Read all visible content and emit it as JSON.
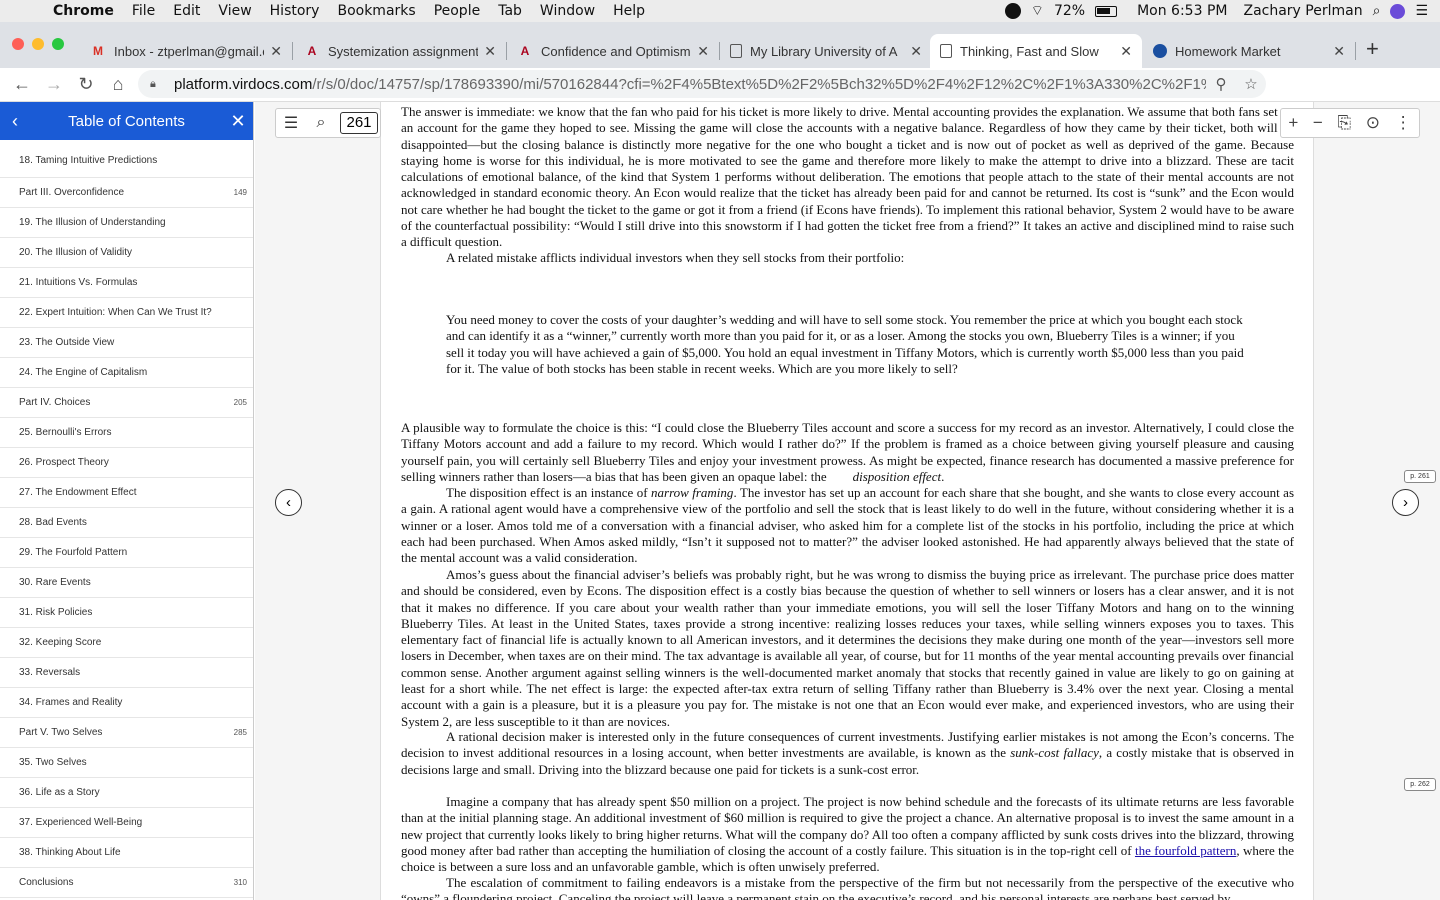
{
  "menubar": {
    "items": [
      "Chrome",
      "File",
      "Edit",
      "View",
      "History",
      "Bookmarks",
      "People",
      "Tab",
      "Window",
      "Help"
    ],
    "battery": "72%",
    "clock": "Mon 6:53 PM",
    "user": "Zachary Perlman"
  },
  "tabs": [
    {
      "title": "Inbox - ztperlman@gmail.c",
      "icon": "gmail-icon"
    },
    {
      "title": "Systemization assignment",
      "icon": "arizona-icon"
    },
    {
      "title": "Confidence and Optimism",
      "icon": "arizona-icon"
    },
    {
      "title": "My Library University of A",
      "icon": "document-icon"
    },
    {
      "title": "Thinking, Fast and Slow",
      "icon": "document-icon"
    },
    {
      "title": "Homework Market",
      "icon": "homework-icon"
    }
  ],
  "address": {
    "host": "platform.virdocs.com",
    "path": "/r/s/0/doc/14757/sp/178693390/mi/570162844?cfi=%2F4%5Btext%5D%2F2%5Bch32%5D%2F4%2F12%2C%2F1%3A330%2C%2F1%3..."
  },
  "sidebar": {
    "title": "Table of Contents",
    "items": [
      {
        "label": "18. Taming Intuitive Predictions",
        "page": ""
      },
      {
        "label": "Part III. Overconfidence",
        "page": "149"
      },
      {
        "label": "19. The Illusion of Understanding",
        "page": ""
      },
      {
        "label": "20. The Illusion of Validity",
        "page": ""
      },
      {
        "label": "21. Intuitions Vs. Formulas",
        "page": ""
      },
      {
        "label": "22. Expert Intuition: When Can We Trust It?",
        "page": ""
      },
      {
        "label": "23. The Outside View",
        "page": ""
      },
      {
        "label": "24. The Engine of Capitalism",
        "page": ""
      },
      {
        "label": "Part IV. Choices",
        "page": "205"
      },
      {
        "label": "25. Bernoulli's Errors",
        "page": ""
      },
      {
        "label": "26. Prospect Theory",
        "page": ""
      },
      {
        "label": "27. The Endowment Effect",
        "page": ""
      },
      {
        "label": "28. Bad Events",
        "page": ""
      },
      {
        "label": "29. The Fourfold Pattern",
        "page": ""
      },
      {
        "label": "30. Rare Events",
        "page": ""
      },
      {
        "label": "31. Risk Policies",
        "page": ""
      },
      {
        "label": "32. Keeping Score",
        "page": ""
      },
      {
        "label": "33. Reversals",
        "page": ""
      },
      {
        "label": "34. Frames and Reality",
        "page": ""
      },
      {
        "label": "Part V. Two Selves",
        "page": "285"
      },
      {
        "label": "35. Two Selves",
        "page": ""
      },
      {
        "label": "36. Life as a Story",
        "page": ""
      },
      {
        "label": "37. Experienced Well-Being",
        "page": ""
      },
      {
        "label": "38. Thinking About Life",
        "page": ""
      },
      {
        "label": "Conclusions",
        "page": "310"
      }
    ]
  },
  "reader": {
    "page_input": "261",
    "page_tag_1": "p. 261",
    "page_tag_2": "p. 262"
  },
  "book": {
    "p1": "The answer is immediate: we know that the fan who paid for his ticket is more likely to drive. Mental accounting provides the explanation. We assume that both fans set up an account for the game they hoped to see. Missing the game will close the accounts with a negative balance. Regardless of how they came by their ticket, both will be disappointed—but the closing balance is distinctly more negative for the one who bought a ticket and is now out of pocket as well as deprived of the game. Because staying home is worse for this individual, he is more motivated to see the game and therefore more likely to make the attempt to drive into a blizzard. These are tacit calculations of emotional balance, of the kind that System 1 performs without deliberation. The emotions that people attach to the state of their mental accounts are not acknowledged in standard economic theory. An Econ would realize that the ticket has already been paid for and cannot be returned. Its cost is “sunk” and the Econ would not care whether he had bought the ticket to the game or got it from a friend (if Econs have friends). To implement this rational behavior, System 2 would have to be aware of the counterfactual possibility: “Would I still drive into this snowstorm if I had gotten the ticket free from a friend?” It takes an active and disciplined mind to raise such a difficult question.",
    "p2": "A related mistake afflicts individual investors when they sell stocks from their portfolio:",
    "q1": "You need money to cover the costs of your daughter’s wedding and will have to sell some stock. You remember the price at which you bought each stock and can identify it as a “winner,” currently worth more than you paid for it, or as a loser. Among the stocks you own, Blueberry Tiles is a winner; if you sell it today you will have achieved a gain of $5,000. You hold an equal investment in Tiffany Motors, which is currently worth $5,000 less than you paid for it. The value of both stocks has been stable in recent weeks. Which are you more likely to sell?",
    "p3": "A plausible way to formulate the choice is this: “I could close the Blueberry Tiles account and score a success for my record as an investor. Alternatively, I could close the Tiffany Motors account and add a failure to my record. Which would I rather do?” If the problem is framed as a choice between giving yourself pleasure and causing yourself pain, you will certainly sell Blueberry Tiles and enjoy your investment prowess. As might be expected, finance research has documented a massive preference for selling winners rather than losers—a bias that has been given an opaque label: the",
    "p3_em": "disposition effect",
    "p4a": "The disposition effect is an instance of",
    "p4_em": "narrow framing",
    "p4b": ". The investor has set up an account for each share that she bought, and she wants to close every account as a gain. A rational agent would have a comprehensive view of the portfolio and sell the stock that is least likely to do well in the future, without considering whether it is a winner or a loser. Amos told me of a conversation with a financial adviser, who asked him for a complete list of the stocks in his portfolio, including the price at which each had been purchased. When Amos asked mildly, “Isn’t it supposed not to matter?” the adviser looked astonished. He had apparently always believed that the state of the mental account was a valid consideration.",
    "p5": "Amos’s guess about the financial adviser’s beliefs was probably right, but he was wrong to dismiss the buying price as irrelevant. The purchase price does matter and should be considered, even by Econs. The disposition effect is a costly bias because the question of whether to sell winners or losers has a clear answer, and it is not that it makes no difference. If you care about your wealth rather than your immediate emotions, you will sell the loser Tiffany Motors and hang on to the winning Blueberry Tiles. At least in the United States, taxes provide a strong incentive: realizing losses reduces your taxes, while selling winners exposes you to taxes. This elementary fact of financial life is actually known to all American investors, and it determines the decisions they make during one month of the year—investors sell more losers in December, when taxes are on their mind. The tax advantage is available all year, of course, but for 11 months of the year mental accounting prevails over financial common sense. Another argument against selling winners is the well-documented market anomaly that stocks that recently gained in value are likely to go on gaining at least for a short while. The net effect is large: the expected after-tax extra return of selling Tiffany rather than Blueberry is 3.4% over the next year. Closing a mental account with a gain is a pleasure, but it is a pleasure you pay for. The mistake is not one that an Econ would ever make, and experienced investors, who are using their System 2, are less susceptible to it than are novices.",
    "p6a": "A rational decision maker is interested only in the future consequences of current investments. Justifying earlier mistakes is not among the Econ’s concerns. The decision to invest additional resources in a losing account, when better investments are available, is known as the",
    "p6_em": "sunk-cost fallacy",
    "p6b": ", a costly mistake that is observed in decisions large and small. Driving into the blizzard because one paid for tickets is a sunk-cost error.",
    "p7a": "Imagine a company that has already spent $50 million on a project. The project is now behind schedule and the forecasts of its ultimate returns are less favorable than at the initial planning stage. An additional investment of $60 million is required to give the project a chance. An alternative proposal is to invest the same amount in a new project that currently looks likely to bring higher returns. What will the company do? All too often a company afflicted by sunk costs drives into the blizzard, throwing good money after bad rather than accepting the humiliation of closing the account of a costly failure. This situation is in the top-right cell of",
    "p7_link": "the fourfold pattern",
    "p7b": ", where the choice is between a sure loss and an unfavorable gamble, which is often unwisely preferred.",
    "p8": "The escalation of commitment to failing endeavors is a mistake from the perspective of the firm but not necessarily from the perspective of the executive who “owns” a floundering project. Canceling the project will leave a permanent stain on the executive’s record, and his personal interests are perhaps best served by"
  }
}
